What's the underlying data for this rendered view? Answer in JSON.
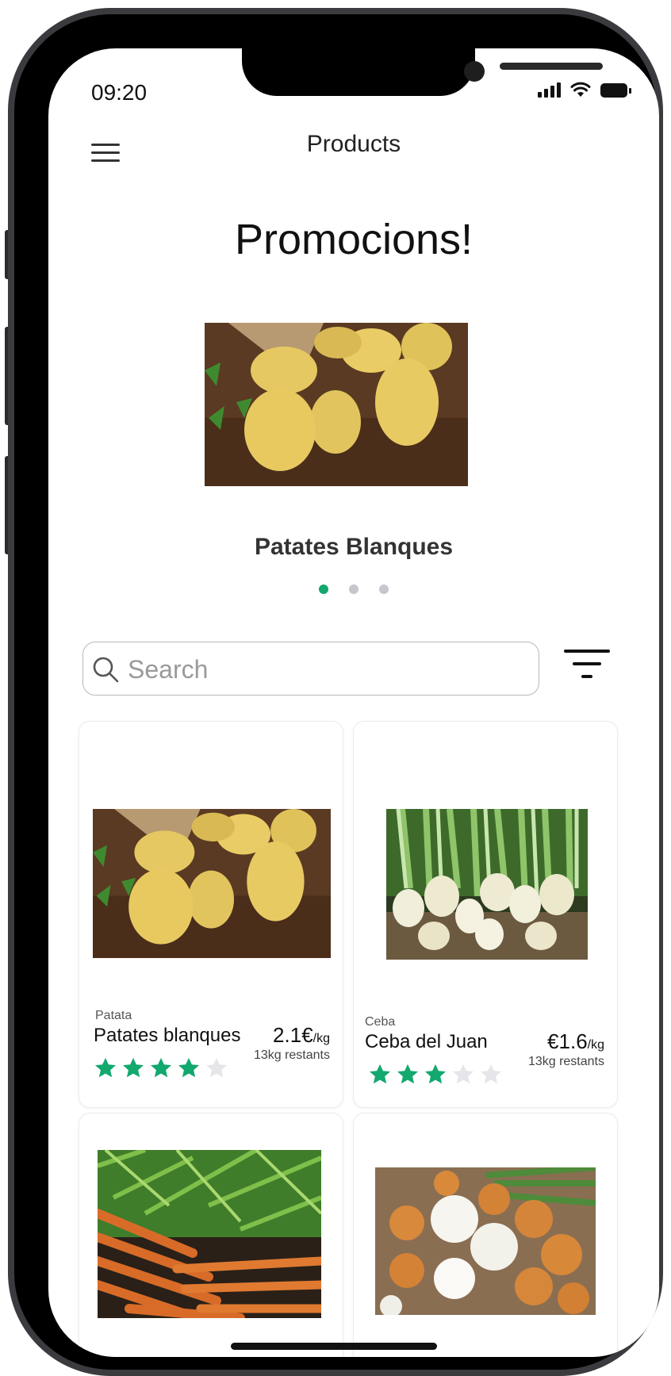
{
  "status_bar": {
    "time": "09:20",
    "icons": [
      "signal-icon",
      "wifi-icon",
      "battery-icon"
    ]
  },
  "app_bar": {
    "title": "Products",
    "menu_icon": "hamburger-menu-icon"
  },
  "promo": {
    "heading": "Promocions!",
    "product_name": "Patates Blanques",
    "carousel_total": 3,
    "carousel_active": 1
  },
  "search": {
    "placeholder": "Search",
    "value": ""
  },
  "filter_icon": "filter-icon",
  "colors": {
    "accent": "#12a86e",
    "star_empty": "#e6e6ea",
    "dot_inactive": "#c6c6cc"
  },
  "products": [
    {
      "category": "Patata",
      "name": "Patates blanques",
      "price": "2.1€",
      "unit": "/kg",
      "stock": "13kg restants",
      "rating": 4,
      "max_rating": 5
    },
    {
      "category": "Ceba",
      "name": "Ceba del Juan",
      "price": "€1.6",
      "unit": "/kg",
      "stock": "13kg restants",
      "rating": 3,
      "max_rating": 5
    },
    {
      "category": "",
      "name": "",
      "price": "",
      "unit": "",
      "stock": "",
      "rating": 0,
      "max_rating": 0
    },
    {
      "category": "",
      "name": "",
      "price": "",
      "unit": "",
      "stock": "",
      "rating": 0,
      "max_rating": 0
    }
  ]
}
